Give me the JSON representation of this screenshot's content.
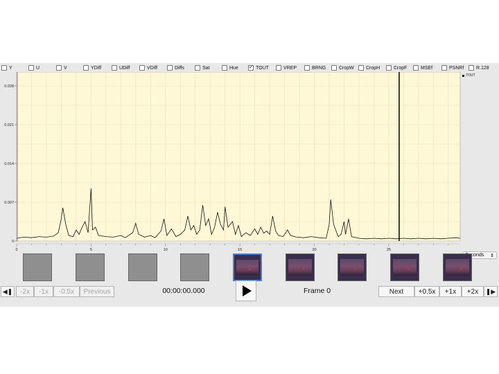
{
  "filters": [
    {
      "label": "Y",
      "checked": false
    },
    {
      "label": "U",
      "checked": false
    },
    {
      "label": "V",
      "checked": false
    },
    {
      "label": "YDiff",
      "checked": false
    },
    {
      "label": "UDiff",
      "checked": false
    },
    {
      "label": "VDiff",
      "checked": false
    },
    {
      "label": "Diffs",
      "checked": false
    },
    {
      "label": "Sat",
      "checked": false
    },
    {
      "label": "Hue",
      "checked": false
    },
    {
      "label": "TOUT",
      "checked": true
    },
    {
      "label": "VREP",
      "checked": false
    },
    {
      "label": "BRNG",
      "checked": false
    },
    {
      "label": "CropW",
      "checked": false
    },
    {
      "label": "CropH",
      "checked": false
    },
    {
      "label": "CropF",
      "checked": false
    },
    {
      "label": "MSEf",
      "checked": false
    },
    {
      "label": "PSNRf",
      "checked": false
    },
    {
      "label": "R.128",
      "checked": false
    }
  ],
  "units_select": {
    "value": "Seconds",
    "chevron": "⇕"
  },
  "transport": {
    "back_frame_icon": "step-back-icon",
    "speeds_back": [
      "-2x",
      "-1x",
      "-0.5x"
    ],
    "previous_label": "Previous",
    "timecode": "00:00:00.000",
    "play_icon": "play-icon",
    "frame_label": "Frame 0",
    "next_label": "Next",
    "speeds_fwd": [
      "+0.5x",
      "+1x",
      "+2x"
    ],
    "fwd_frame_icon": "step-forward-icon"
  },
  "thumbnails": [
    "blank",
    "blank",
    "blank",
    "blank",
    "image-current",
    "image",
    "image",
    "image",
    "image"
  ],
  "chart_data": {
    "type": "line",
    "series": [
      {
        "name": "TOUT",
        "color": "#111111"
      }
    ],
    "xlim": [
      0,
      29.8
    ],
    "ylim": [
      0,
      0.03
    ],
    "x_ticks": [
      0,
      5,
      10,
      15,
      20,
      25
    ],
    "y_ticks": [
      0,
      0.007,
      0.014,
      0.021,
      0.028
    ],
    "y_tick_labels": [
      "0",
      "0.007",
      "0.014",
      "0.021",
      "0.028"
    ],
    "grid": true,
    "background": "#fff8d6",
    "cursor_x": 25.7,
    "points": [
      [
        0,
        0.0005
      ],
      [
        0.5,
        0.0007
      ],
      [
        1,
        0.0006
      ],
      [
        1.5,
        0.0008
      ],
      [
        2,
        0.0007
      ],
      [
        2.5,
        0.0009
      ],
      [
        2.8,
        0.0015
      ],
      [
        3.0,
        0.004
      ],
      [
        3.1,
        0.006
      ],
      [
        3.3,
        0.003
      ],
      [
        3.5,
        0.001
      ],
      [
        3.8,
        0.0008
      ],
      [
        4.0,
        0.002
      ],
      [
        4.2,
        0.0012
      ],
      [
        4.4,
        0.0025
      ],
      [
        4.6,
        0.0035
      ],
      [
        4.8,
        0.0015
      ],
      [
        5.0,
        0.0095
      ],
      [
        5.1,
        0.002
      ],
      [
        5.3,
        0.0025
      ],
      [
        5.5,
        0.001
      ],
      [
        6.0,
        0.0008
      ],
      [
        6.5,
        0.0007
      ],
      [
        7.0,
        0.001
      ],
      [
        7.3,
        0.0006
      ],
      [
        7.8,
        0.0015
      ],
      [
        8.0,
        0.0032
      ],
      [
        8.2,
        0.0012
      ],
      [
        8.6,
        0.0007
      ],
      [
        9.0,
        0.001
      ],
      [
        9.3,
        0.0006
      ],
      [
        9.7,
        0.0018
      ],
      [
        9.9,
        0.004
      ],
      [
        10.1,
        0.001
      ],
      [
        10.4,
        0.0022
      ],
      [
        10.7,
        0.0008
      ],
      [
        11.0,
        0.0012
      ],
      [
        11.3,
        0.002
      ],
      [
        11.5,
        0.0045
      ],
      [
        11.7,
        0.002
      ],
      [
        11.9,
        0.0028
      ],
      [
        12.1,
        0.0012
      ],
      [
        12.3,
        0.002
      ],
      [
        12.5,
        0.0065
      ],
      [
        12.7,
        0.0028
      ],
      [
        12.9,
        0.004
      ],
      [
        13.1,
        0.0012
      ],
      [
        13.3,
        0.0025
      ],
      [
        13.5,
        0.0052
      ],
      [
        13.7,
        0.003
      ],
      [
        13.9,
        0.002
      ],
      [
        14.0,
        0.0062
      ],
      [
        14.2,
        0.0025
      ],
      [
        14.5,
        0.0035
      ],
      [
        14.7,
        0.0012
      ],
      [
        14.9,
        0.0028
      ],
      [
        15.1,
        0.0008
      ],
      [
        15.4,
        0.0015
      ],
      [
        15.7,
        0.001
      ],
      [
        16.0,
        0.0022
      ],
      [
        16.2,
        0.0012
      ],
      [
        16.4,
        0.0025
      ],
      [
        16.6,
        0.0014
      ],
      [
        16.8,
        0.0018
      ],
      [
        17.0,
        0.0012
      ],
      [
        17.2,
        0.0045
      ],
      [
        17.4,
        0.0018
      ],
      [
        17.6,
        0.001
      ],
      [
        17.9,
        0.0008
      ],
      [
        18.2,
        0.002
      ],
      [
        18.4,
        0.001
      ],
      [
        18.8,
        0.0007
      ],
      [
        19.3,
        0.0006
      ],
      [
        19.8,
        0.0008
      ],
      [
        20.3,
        0.0006
      ],
      [
        20.8,
        0.0005
      ],
      [
        21.0,
        0.003
      ],
      [
        21.1,
        0.0075
      ],
      [
        21.3,
        0.003
      ],
      [
        21.6,
        0.0008
      ],
      [
        21.8,
        0.0012
      ],
      [
        22.0,
        0.0035
      ],
      [
        22.1,
        0.0012
      ],
      [
        22.3,
        0.004
      ],
      [
        22.5,
        0.0008
      ],
      [
        23.0,
        0.0005
      ],
      [
        23.5,
        0.0004
      ],
      [
        24.0,
        0.0005
      ],
      [
        24.5,
        0.0004
      ],
      [
        25.0,
        0.0005
      ],
      [
        25.5,
        0.0004
      ],
      [
        26.0,
        0.0005
      ],
      [
        26.5,
        0.0004
      ],
      [
        27.0,
        0.0005
      ],
      [
        27.5,
        0.0004
      ],
      [
        28.0,
        0.0005
      ],
      [
        28.5,
        0.0004
      ],
      [
        29.0,
        0.0005
      ],
      [
        29.5,
        0.0006
      ],
      [
        29.8,
        0.0005
      ]
    ]
  }
}
